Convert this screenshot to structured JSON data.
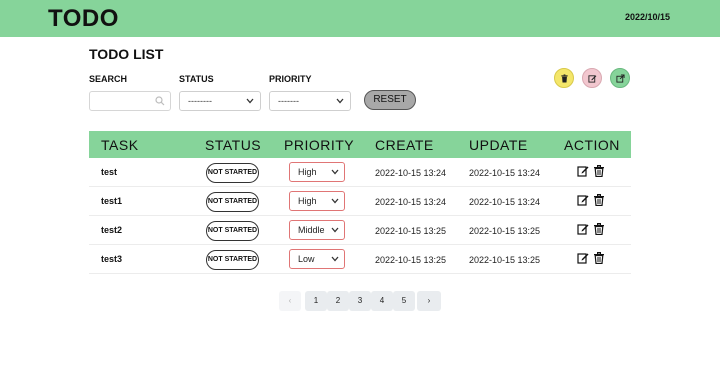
{
  "header": {
    "logo": "TODO",
    "date": "2022/10/15"
  },
  "page": {
    "title": "TODO LIST"
  },
  "filters": {
    "search_label": "SEARCH",
    "search_placeholder": "",
    "status_label": "STATUS",
    "status_value": "--------",
    "priority_label": "PRIORITY",
    "priority_value": "-------",
    "reset_label": "RESET"
  },
  "actions": [
    {
      "icon": "trash-icon",
      "color": "#f4e66a"
    },
    {
      "icon": "edit-icon",
      "color": "#f2c7cf"
    },
    {
      "icon": "external-link-icon",
      "color": "#86d49a"
    }
  ],
  "table": {
    "header_color": "#86d49a",
    "columns": [
      "TASK",
      "STATUS",
      "PRIORITY",
      "CREATE",
      "UPDATE",
      "ACTION"
    ],
    "rows": [
      {
        "task": "test",
        "status": "NOT STARTED",
        "priority": "High",
        "create": "2022-10-15 13:24",
        "update": "2022-10-15 13:24"
      },
      {
        "task": "test1",
        "status": "NOT STARTED",
        "priority": "High",
        "create": "2022-10-15 13:24",
        "update": "2022-10-15 13:24"
      },
      {
        "task": "test2",
        "status": "NOT STARTED",
        "priority": "Middle",
        "create": "2022-10-15 13:25",
        "update": "2022-10-15 13:25"
      },
      {
        "task": "test3",
        "status": "NOT STARTED",
        "priority": "Low",
        "create": "2022-10-15 13:25",
        "update": "2022-10-15 13:25"
      }
    ]
  },
  "pagination": {
    "prev": "‹",
    "pages": [
      "1",
      "2",
      "3",
      "4",
      "5"
    ],
    "next": "›"
  }
}
